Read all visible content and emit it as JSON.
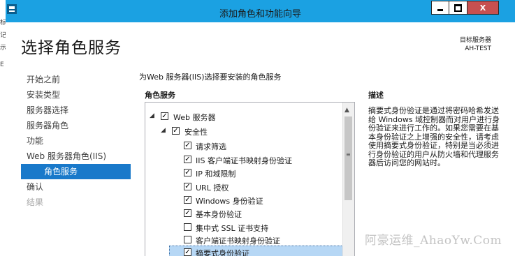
{
  "window": {
    "title": "添加角色和功能向导",
    "minimize_icon": "minimize-icon",
    "maximize_icon": "maximize-icon",
    "close_label": "X",
    "accent": "#1ba1e2",
    "close_color": "#c75050"
  },
  "outer_strip": {
    "marks": [
      "标",
      "记",
      "示",
      "E"
    ]
  },
  "page": {
    "title": "选择角色服务",
    "target_label": "目标服务器",
    "target_name": "AH-TEST"
  },
  "nav": {
    "items": [
      {
        "label": "开始之前"
      },
      {
        "label": "安装类型"
      },
      {
        "label": "服务器选择"
      },
      {
        "label": "服务器角色"
      },
      {
        "label": "功能"
      },
      {
        "label": "Web 服务器角色(IIS)"
      },
      {
        "label": "角色服务"
      },
      {
        "label": "确认"
      },
      {
        "label": "结果"
      }
    ],
    "selected_color": "#1979ca"
  },
  "main": {
    "instruction": "为Web 服务器(IIS)选择要安装的角色服务",
    "roles_header": "角色服务",
    "tree": [
      {
        "label": "Web 服务器",
        "checked": true,
        "expander": "◢"
      },
      {
        "label": "安全性",
        "checked": true,
        "expander": "◢"
      },
      {
        "label": "请求筛选",
        "checked": true
      },
      {
        "label": "IIS 客户端证书映射身份验证",
        "checked": true
      },
      {
        "label": "IP 和域限制",
        "checked": true
      },
      {
        "label": "URL 授权",
        "checked": true
      },
      {
        "label": "Windows 身份验证",
        "checked": true
      },
      {
        "label": "基本身份验证",
        "checked": true
      },
      {
        "label": "集中式 SSL 证书支持",
        "checked": false
      },
      {
        "label": "客户端证书映射身份验证",
        "checked": false
      },
      {
        "label": "摘要式身份验证",
        "checked": true,
        "selected": true
      }
    ]
  },
  "description": {
    "header": "描述",
    "text": "摘要式身份验证是通过将密码哈希发送给 Windows 域控制器而对用户进行身份验证来进行工作的。如果您需要在基本身份验证之上增强的安全性，请考虑使用摘要式身份验证，特别是当必须进行身份验证的用户从防火墙和代理服务器后访问您的网站时。"
  },
  "watermark": "阿豪运维_AhaoYw.Com"
}
